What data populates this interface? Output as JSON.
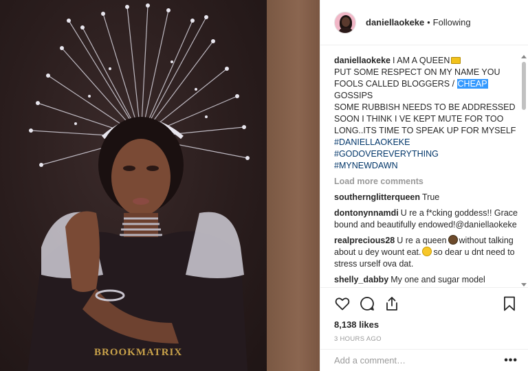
{
  "post": {
    "watermark": "BROOKMATRIX"
  },
  "header": {
    "username": "daniellaokeke",
    "separator": "•",
    "follow_status": "Following"
  },
  "caption": {
    "username": "daniellaokeke",
    "line1": "I AM A QUEEN",
    "line2a": "PUT SOME RESPECT ON MY NAME YOU FOOLS CALLED BLOGGERS / ",
    "line2_highlight": "CHEAP",
    "line2b": "GOSSIPS",
    "line3": "SOME RUBBISH NEEDS TO BE ADDRESSED SOON I THINK I VE KEPT MUTE FOR TOO LONG..ITS TIME TO SPEAK UP FOR MYSELF",
    "hashtags": [
      "#DANIELLAOKEKE",
      "#GODOVEREVERYTHING",
      "#MYNEWDAWN"
    ]
  },
  "load_more": "Load more comments",
  "comments": [
    {
      "user": "southernglitterqueen",
      "text": "True"
    },
    {
      "user": "dontonynnamdi",
      "text": "U re a f*cking goddess!! Grace bound and beautifully endowed!@daniellaokeke"
    },
    {
      "user": "realprecious28",
      "text_a": "U re a queen",
      "text_b": "without talking about u dey wount eat.",
      "text_c": "so dear u dnt need to stress urself ova dat."
    },
    {
      "user": "shelly_dabby",
      "text": "My one and sugar model"
    }
  ],
  "actions": {
    "likes": "8,138 likes",
    "time": "3 HOURS AGO"
  },
  "add_comment": {
    "placeholder": "Add a comment…",
    "more": "•••"
  },
  "colors": {
    "hashtag": "#003569",
    "muted": "#999999",
    "highlight": "#3399ff",
    "photo_bg": "#2a1d1d",
    "photo_strip": "#8b6650"
  }
}
